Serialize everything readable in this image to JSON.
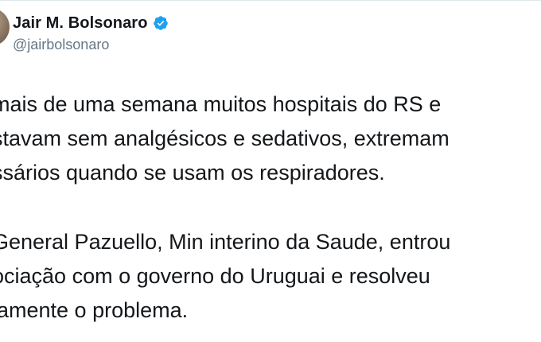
{
  "author": {
    "display_name": "Jair M. Bolsonaro",
    "handle": "@jairbolsonaro",
    "verified_icon": "verified-badge-icon",
    "verified_color": "#1da1f2"
  },
  "tweet": {
    "paragraph1": [
      "mais de uma semana muitos hospitais do RS e",
      "stavam sem analgésicos e sedativos, extremam",
      "ssários quando se usam os respiradores."
    ],
    "paragraph2": [
      "General Pazuello, Min interino da Saude, entrou",
      "ociação com o governo do Uruguai e resolveu",
      "lamente o problema."
    ]
  },
  "colors": {
    "text": "#14171a",
    "secondary": "#657786",
    "background": "#ffffff"
  }
}
